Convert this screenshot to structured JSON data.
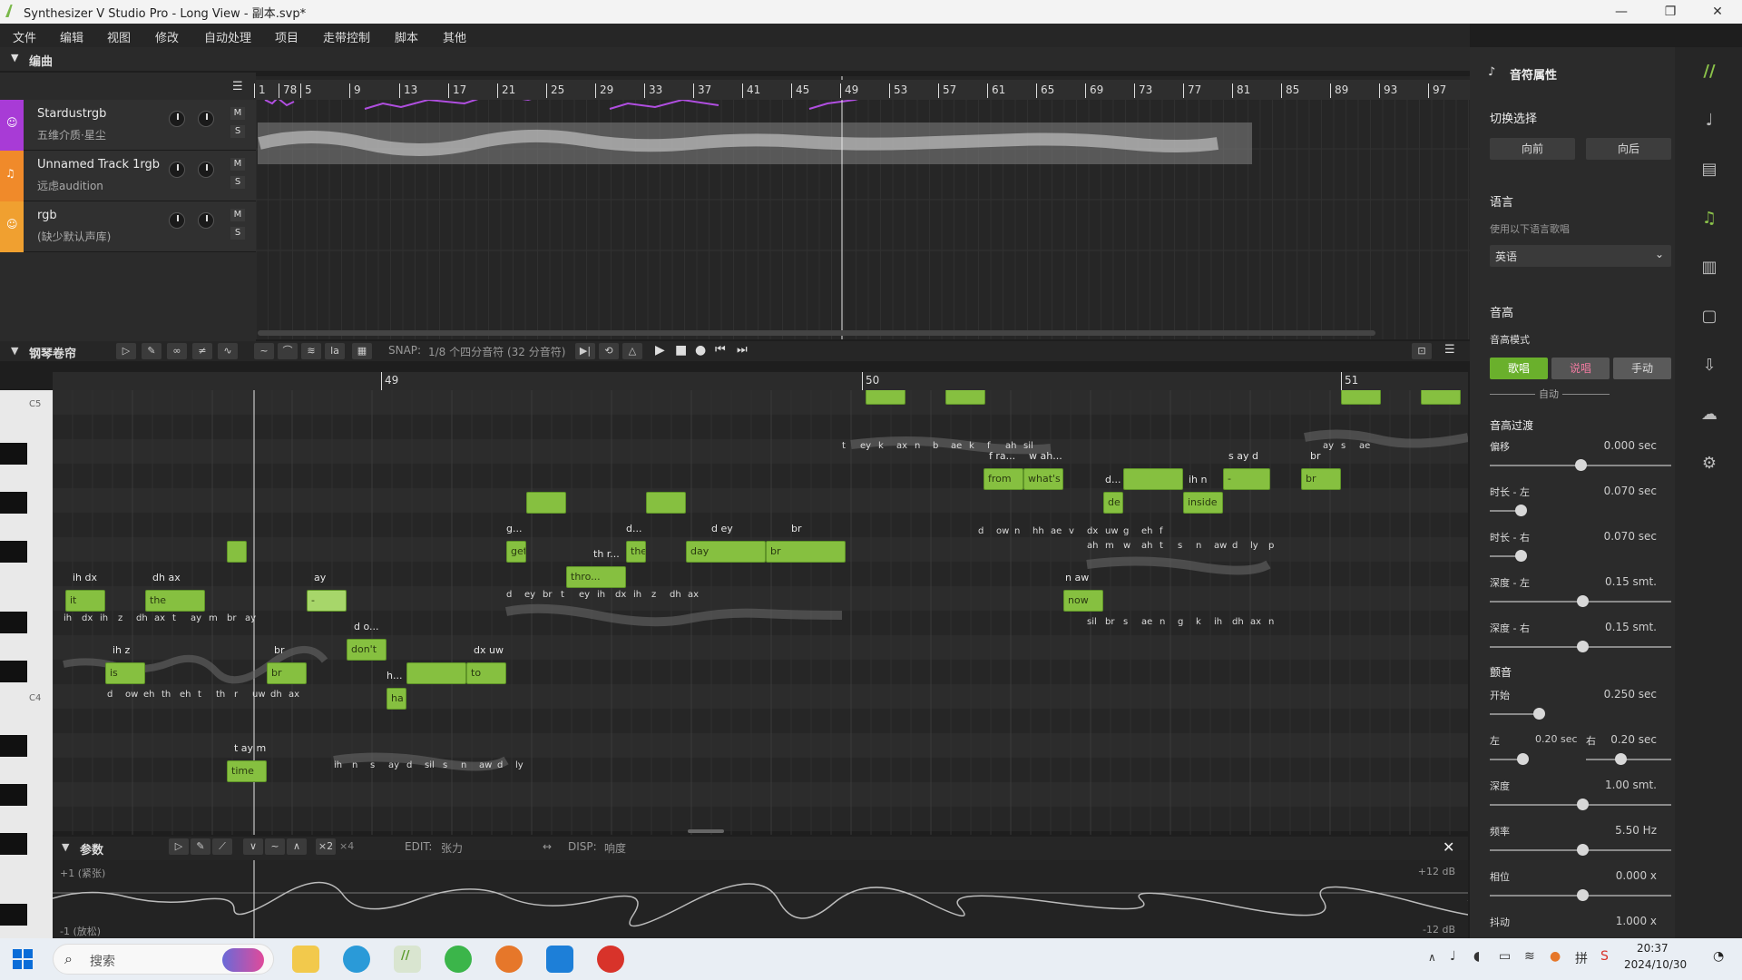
{
  "window": {
    "title": "Synthesizer V Studio Pro - Long View - 副本.svp*",
    "minimize": "—",
    "maximize": "❐",
    "close": "✕"
  },
  "menu": [
    "文件",
    "编辑",
    "视图",
    "修改",
    "自动处理",
    "项目",
    "走带控制",
    "脚本",
    "其他"
  ],
  "arrangement": {
    "section_title": "编曲",
    "ruler": [
      "1",
      "78",
      "5",
      "9",
      "13",
      "17",
      "21",
      "25",
      "29",
      "33",
      "37",
      "41",
      "45",
      "49",
      "53",
      "57",
      "61",
      "65",
      "69",
      "73",
      "77",
      "81",
      "85",
      "89",
      "93",
      "97"
    ],
    "tracks": [
      {
        "name": "Stardustrgb",
        "voice": "五维介质·星尘",
        "mute": "M",
        "solo": "S",
        "color": "#a83bd6"
      },
      {
        "name": "Unnamed Track 1rgb",
        "voice": "远虑audition",
        "mute": "M",
        "solo": "S",
        "color": "#f08a2a"
      },
      {
        "name": "rgb",
        "voice": "(缺少默认声库)",
        "mute": "M",
        "solo": "S",
        "color": "#f0a030"
      }
    ]
  },
  "pianoroll": {
    "section_title": "钢琴卷帘",
    "snap_label": "SNAP:",
    "snap_value": "1/8 个四分音符 (32 分音符)",
    "measures": [
      "49",
      "50",
      "51"
    ],
    "key_labels": [
      "C5",
      "C4"
    ],
    "notes": [
      {
        "lyric": "it",
        "phon": "ih dx"
      },
      {
        "lyric": "is",
        "phon": "ih z"
      },
      {
        "lyric": "the",
        "phon": "dh ax"
      },
      {
        "lyric": "time",
        "phon": "t ay m"
      },
      {
        "lyric": "br",
        "phon": "br"
      },
      {
        "lyric": "-",
        "phon": "ay"
      },
      {
        "lyric": "don't",
        "phon": "d o..."
      },
      {
        "lyric": "ha",
        "phon": "h..."
      },
      {
        "lyric": "to",
        "phon": "dx uw"
      },
      {
        "lyric": "get",
        "phon": "g..."
      },
      {
        "lyric": "thro...",
        "phon": "th r..."
      },
      {
        "lyric": "the",
        "phon": "d..."
      },
      {
        "lyric": "day",
        "phon": "d ey"
      },
      {
        "lyric": "br",
        "phon": "br"
      },
      {
        "lyric": "from",
        "phon": "f ra..."
      },
      {
        "lyric": "what's",
        "phon": "w ah..."
      },
      {
        "lyric": "de",
        "phon": "d..."
      },
      {
        "lyric": "inside",
        "phon": "ih n"
      },
      {
        "lyric": "now",
        "phon": "n aw"
      },
      {
        "lyric": "-",
        "phon": "s ay d"
      },
      {
        "lyric": "br",
        "phon": "br"
      }
    ],
    "ref_phonemes": [
      "t",
      "ey",
      "k",
      "ax",
      "n",
      "b",
      "ae",
      "k",
      "f",
      "ah",
      "sil",
      "ih",
      "dx",
      "ih",
      "z",
      "dh",
      "ax",
      "t",
      "ay",
      "m",
      "br",
      "ay",
      "d",
      "ow",
      "eh",
      "th",
      "eh",
      "t",
      "th",
      "r",
      "uw",
      "dh",
      "ax",
      "d",
      "ey",
      "br",
      "t",
      "ey",
      "ih",
      "dx",
      "ih",
      "z",
      "dh",
      "ax",
      "d",
      "ow",
      "n",
      "hh",
      "ae",
      "v",
      "dx",
      "uw",
      "g",
      "eh",
      "f",
      "ah",
      "m",
      "w",
      "ah",
      "t",
      "s",
      "n",
      "aw",
      "d",
      "ly",
      "p",
      "ih",
      "n",
      "s",
      "ay",
      "d",
      "sil",
      "s",
      "n",
      "aw",
      "d",
      "ly",
      "sil",
      "br",
      "s",
      "ae",
      "n",
      "g",
      "k",
      "ih",
      "dh",
      "ax",
      "n",
      "ay",
      "s",
      "ae"
    ]
  },
  "params": {
    "section_title": "参数",
    "edit_label": "EDIT:",
    "edit_value": "张力",
    "disp_label": "DISP:",
    "disp_value": "响度",
    "top_label": "+1 (紧张)",
    "bottom_label": "-1 (放松)",
    "top_db": "+12 dB",
    "bottom_db": "-12 dB",
    "x2": "×2",
    "x4": "×4"
  },
  "properties": {
    "title": "音符属性",
    "switch_select": "切换选择",
    "prev": "向前",
    "next": "向后",
    "language": "语言",
    "use_language": "使用以下语言歌唱",
    "language_value": "英语",
    "pitch": "音高",
    "pitch_mode": "音高模式",
    "mode_sing": "歌唱",
    "mode_rap": "说唱",
    "mode_manual": "手动",
    "auto": "自动",
    "pitch_transition": "音高过渡",
    "offset": "偏移",
    "offset_val": "0.000 sec",
    "dur_left": "时长 - 左",
    "dur_left_val": "0.070 sec",
    "dur_right": "时长 - 右",
    "dur_right_val": "0.070 sec",
    "depth_left": "深度 - 左",
    "depth_left_val": "0.15 smt.",
    "depth_right": "深度 - 右",
    "depth_right_val": "0.15 smt.",
    "vibrato": "颤音",
    "start": "开始",
    "start_val": "0.250 sec",
    "left": "左",
    "left_val": "0.20 sec",
    "right": "右",
    "right_val": "0.20 sec",
    "depth": "深度",
    "depth_val": "1.00 smt.",
    "freq": "频率",
    "freq_val": "5.50 Hz",
    "phase": "相位",
    "phase_val": "0.000 x",
    "jitter": "抖动",
    "jitter_val": "1.000 x"
  },
  "taskbar": {
    "search_placeholder": "搜索",
    "time": "20:37",
    "date": "2024/10/30"
  }
}
